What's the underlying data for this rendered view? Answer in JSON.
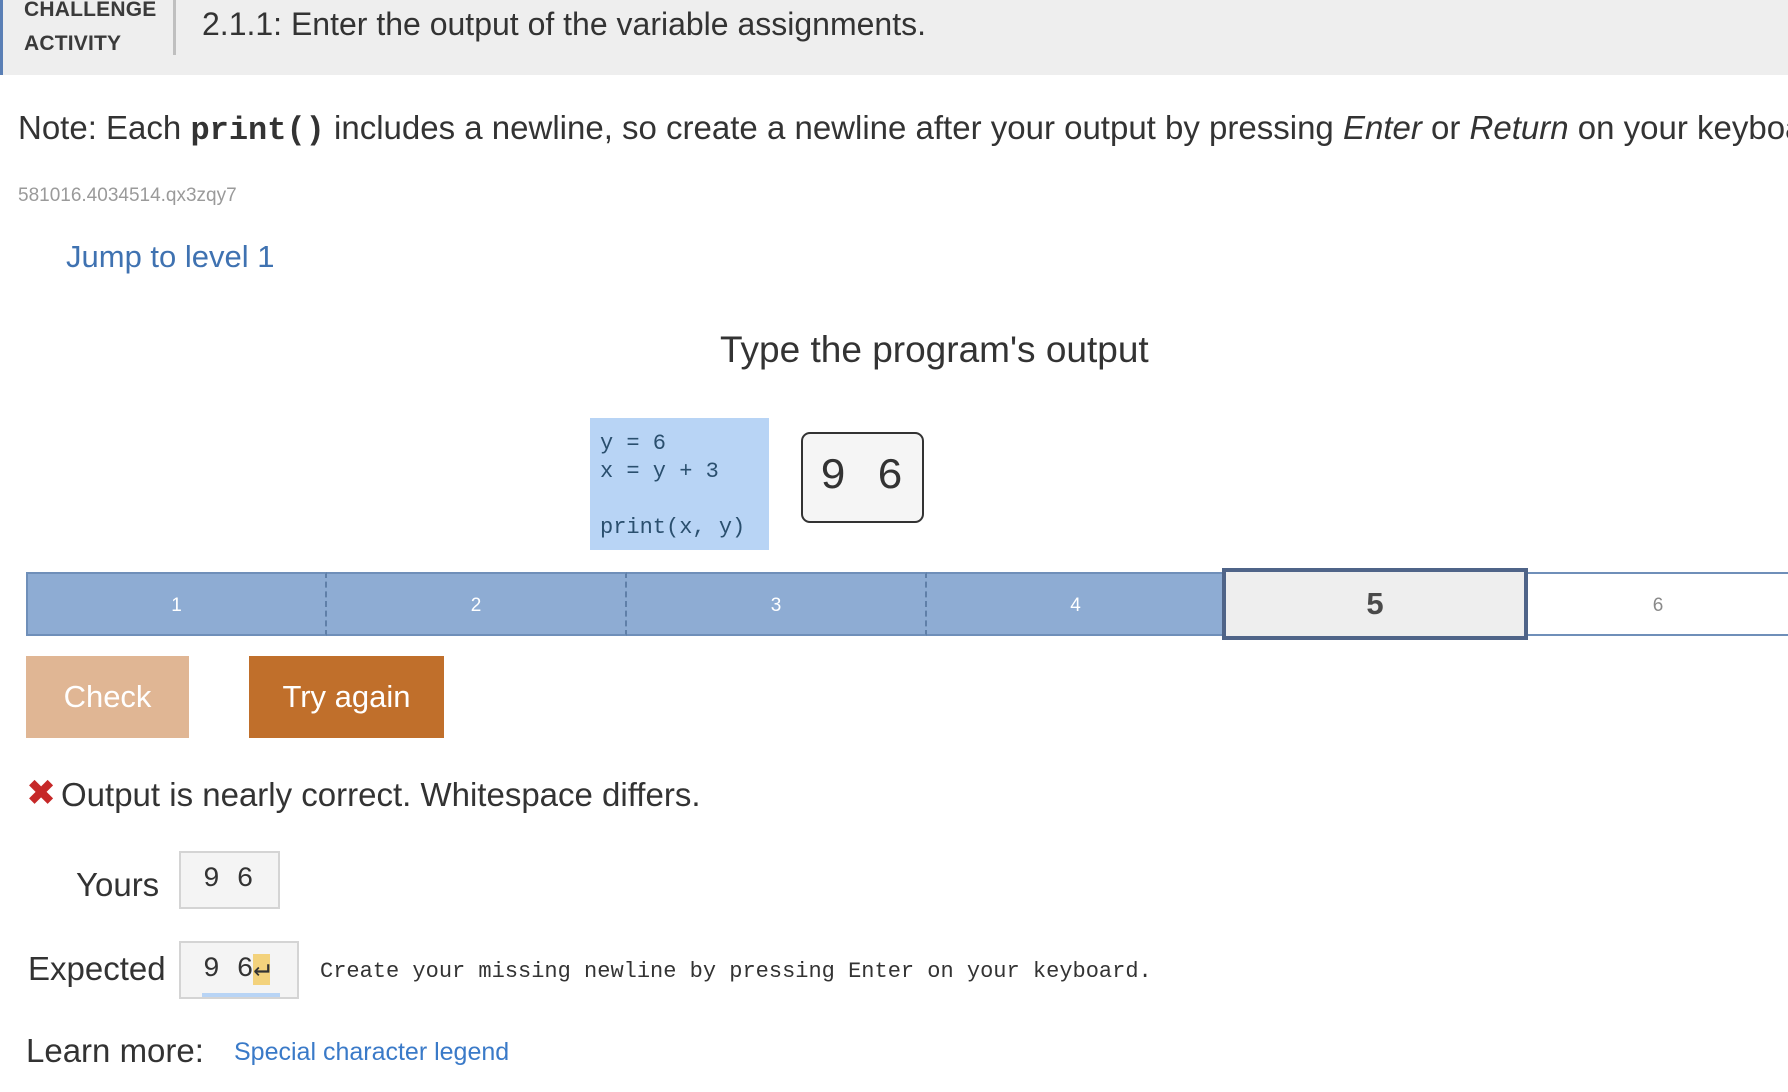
{
  "header": {
    "label_line1": "CHALLENGE",
    "label_line2": "ACTIVITY",
    "title": "2.1.1: Enter the output of the variable assignments."
  },
  "note": {
    "prefix": "Note: Each ",
    "code": "print()",
    "middle": " includes a newline, so create a newline after your output by pressing ",
    "key1": "Enter",
    "or": " or ",
    "key2": "Return",
    "suffix": " on your keyboard."
  },
  "activity_id": "581016.4034514.qx3zqy7",
  "jump_link": "Jump to level 1",
  "prompt_title": "Type the program's output",
  "code_lines": [
    "y = 6",
    "x = y + 3",
    "",
    "print(x, y)"
  ],
  "answer_value": "9 6",
  "levels": [
    {
      "label": "1",
      "state": "done"
    },
    {
      "label": "2",
      "state": "done"
    },
    {
      "label": "3",
      "state": "done"
    },
    {
      "label": "4",
      "state": "done"
    },
    {
      "label": "5",
      "state": "current"
    },
    {
      "label": "6",
      "state": "future"
    }
  ],
  "buttons": {
    "check": "Check",
    "try_again": "Try again"
  },
  "feedback": {
    "icon": "error-x-icon",
    "message": "Output is nearly correct. Whitespace differs.",
    "yours_label": "Yours",
    "yours_value": "9 6",
    "expected_label": "Expected",
    "expected_value": "9 6",
    "newline_glyph": "↵",
    "missing_message": "Create your missing newline by pressing Enter on your keyboard."
  },
  "learn_more": {
    "label": "Learn more:",
    "link": "Special character legend"
  },
  "colors": {
    "header_bg": "#eeeeee",
    "code_bg": "#b8d4f5",
    "level_done": "#8eacd3",
    "check_button": "#e0b694",
    "try_again_button": "#c06f2b",
    "error": "#c62828",
    "link": "#3a7ac8"
  }
}
